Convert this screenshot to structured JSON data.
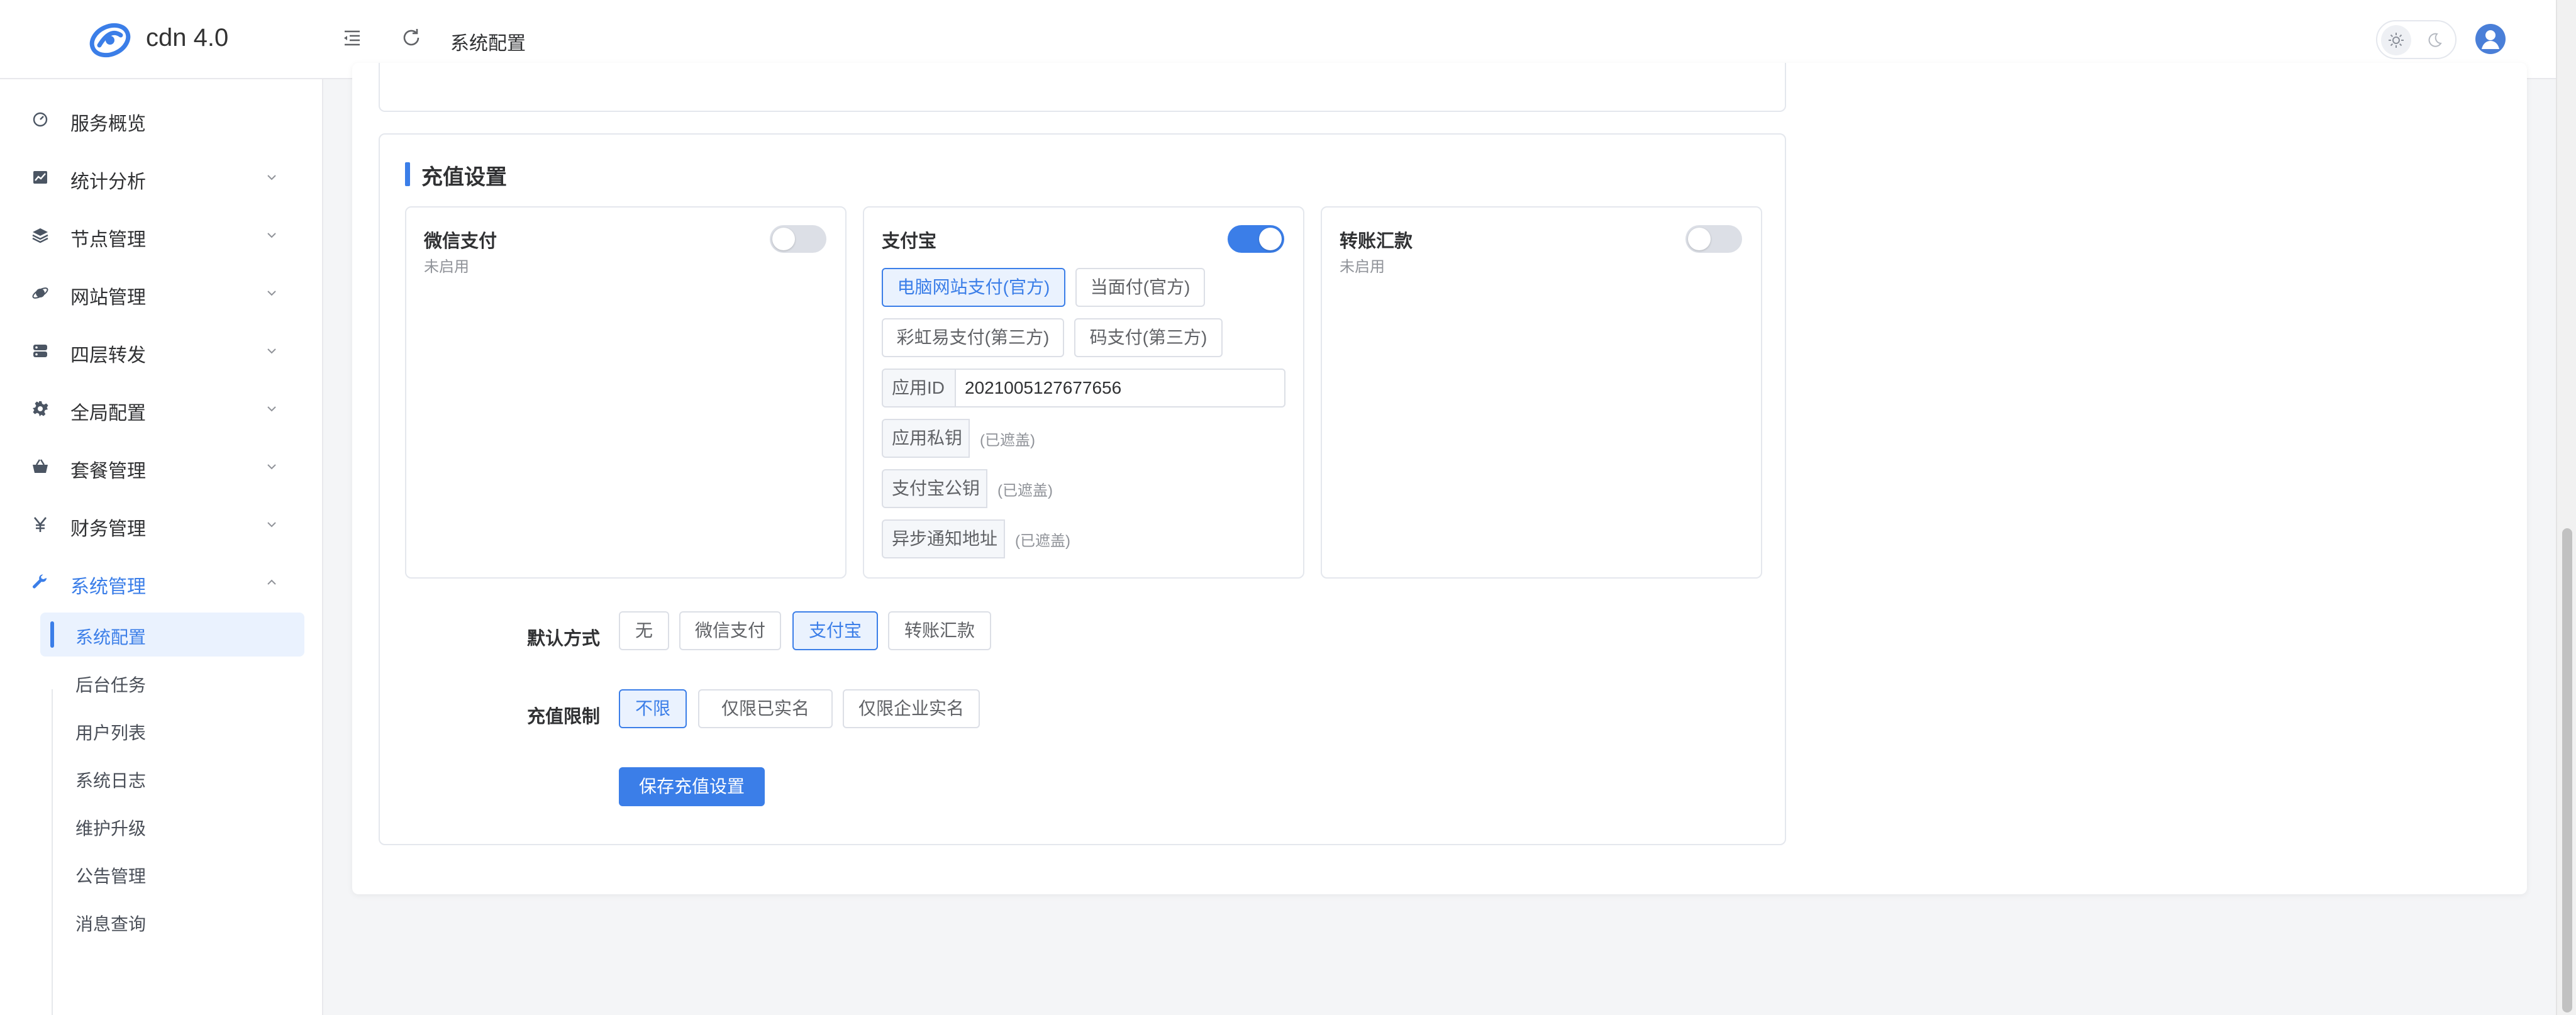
{
  "header": {
    "brand": "cdn 4.0",
    "breadcrumb": "系统配置"
  },
  "sidebar": {
    "items": [
      {
        "label": "服务概览",
        "icon": "dashboard-icon"
      },
      {
        "label": "统计分析",
        "icon": "chart-icon"
      },
      {
        "label": "节点管理",
        "icon": "layers-icon"
      },
      {
        "label": "网站管理",
        "icon": "planet-icon"
      },
      {
        "label": "四层转发",
        "icon": "server-icon"
      },
      {
        "label": "全局配置",
        "icon": "gear-icon"
      },
      {
        "label": "套餐管理",
        "icon": "basket-icon"
      },
      {
        "label": "财务管理",
        "icon": "yen-icon"
      },
      {
        "label": "系统管理",
        "icon": "wrench-icon"
      }
    ],
    "sub_items": [
      "系统配置",
      "后台任务",
      "用户列表",
      "系统日志",
      "维护升级",
      "公告管理",
      "消息查询"
    ]
  },
  "recharge": {
    "title": "充值设置",
    "wechat": {
      "name": "微信支付",
      "status": "未启用",
      "enabled": false
    },
    "alipay": {
      "name": "支付宝",
      "enabled": true,
      "options": [
        "电脑网站支付(官方)",
        "当面付(官方)",
        "彩虹易支付(第三方)",
        "码支付(第三方)"
      ],
      "selected_option": "电脑网站支付(官方)",
      "fields": [
        {
          "label": "应用ID",
          "value": "2021005127677656"
        },
        {
          "label": "应用私钥",
          "note": "(已遮盖)"
        },
        {
          "label": "支付宝公钥",
          "note": "(已遮盖)"
        },
        {
          "label": "异步通知地址",
          "note": "(已遮盖)"
        }
      ]
    },
    "transfer": {
      "name": "转账汇款",
      "status": "未启用",
      "enabled": false
    },
    "default_method": {
      "label": "默认方式",
      "options": [
        "无",
        "微信支付",
        "支付宝",
        "转账汇款"
      ],
      "selected": "支付宝"
    },
    "limit": {
      "label": "充值限制",
      "options": [
        "不限",
        "仅限已实名",
        "仅限企业实名"
      ],
      "selected": "不限"
    },
    "save_label": "保存充值设置"
  },
  "colors": {
    "accent": "#3b7ee8",
    "accent_light": "#eaf2fe",
    "border": "#e4e7ed",
    "background": "#f4f5f7"
  }
}
